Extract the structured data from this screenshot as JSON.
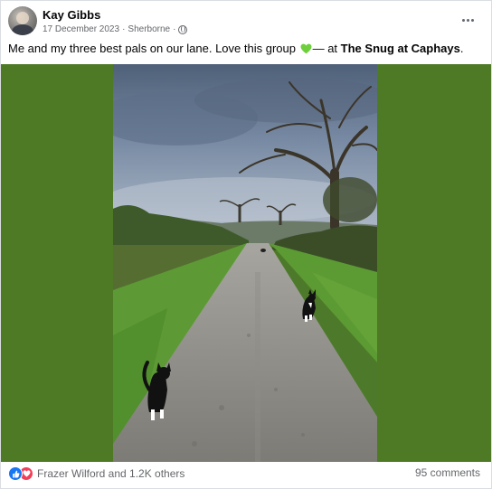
{
  "post": {
    "author": "Kay Gibbs",
    "date": "17 December 2023",
    "separator": "·",
    "location": "Sherborne",
    "separator2": "·",
    "text_main": "Me and my three best pals on our lane. Love this group ",
    "text_at": "— at ",
    "place": "The Snug at Caphays",
    "text_end": "."
  },
  "icons": {
    "avatar": "avatar",
    "audience": "globe-icon",
    "menu": "more-horizontal-icon",
    "emoji": "green-heart-icon",
    "reaction_like": "like-icon",
    "reaction_love": "love-icon"
  },
  "footer": {
    "reactions_text": "Frazer Wilford and 1.2K others",
    "comments_text": "95 comments"
  },
  "colors": {
    "media_background": "#4e7a25",
    "like": "#1877f2",
    "love": "#f33e58",
    "heart_emoji": "#6ccf3b"
  }
}
